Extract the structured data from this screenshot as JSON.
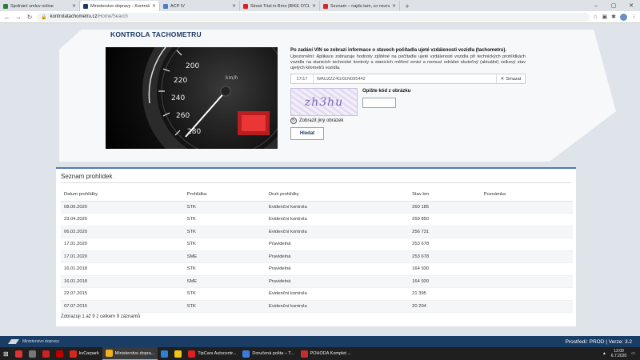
{
  "browser": {
    "tabs": [
      {
        "title": "Sjednání smluv online",
        "color": "#2a7d3f",
        "active": false
      },
      {
        "title": "Ministerstvo dopravy - Kontrola",
        "color": "#1d3b66",
        "active": true
      },
      {
        "title": "ACP IV",
        "color": "#4b7bc9",
        "active": false
      },
      {
        "title": "Street Trial in Brno |BIKE O'CLOCK",
        "color": "#e02020",
        "active": false
      },
      {
        "title": "Seznam – najdu tam, co neznám",
        "color": "#d6262b",
        "active": false
      }
    ],
    "new_tab": "+",
    "window_controls": [
      "–",
      "▢",
      "✕"
    ],
    "address_host": "kontrolatachometru.cz",
    "address_path": "/Home/Search"
  },
  "hero": {
    "title": "KONTROLA TACHOMETRU",
    "description_title": "Po zadání VIN se zobrazí informace o stavech počítadla ujeté vzdálenosti vozidla (tachometru).",
    "description": "Upozornění: Aplikace zobrazuje hodnoty zjištěné na počítadle ujeté vzdálenosti vozidla při technických prohlídkách vozidla na stanicích technické kontroly a stanicích měření emisí a nemusí odrážet skutečný (aktuální) celkový stav ujetých kilometrů vozidla.",
    "vin_counter": "17/17",
    "vin_value": "WAUZZZ4GXEN095442",
    "clear_label": "Smazat",
    "captcha_text": "zh3hu",
    "captcha_label": "Opište kód z obrázku",
    "reload_label": "Zobrazit jiný obrázek",
    "search_button": "Hledat",
    "speedo_labels": [
      "200",
      "220",
      "240",
      "260",
      "280",
      "km/h"
    ]
  },
  "inspections": {
    "title": "Seznam prohlídek",
    "columns": [
      "Datum prohlídky",
      "Prohlídka",
      "Druh prohlídky",
      "Stav km",
      "Poznámka"
    ],
    "rows": [
      [
        "08.06.2020",
        "STK",
        "Evidenční kontrola",
        "260 185",
        ""
      ],
      [
        "23.04.2020",
        "STK",
        "Evidenční kontrola",
        "259 850",
        ""
      ],
      [
        "06.02.2020",
        "STK",
        "Evidenční kontrola",
        "256 731",
        ""
      ],
      [
        "17.01.2020",
        "STK",
        "Pravidelná",
        "253 678",
        ""
      ],
      [
        "17.01.2020",
        "SME",
        "Pravidelná",
        "253 678",
        ""
      ],
      [
        "16.01.2018",
        "STK",
        "Pravidelná",
        "164 930",
        ""
      ],
      [
        "16.01.2018",
        "SME",
        "Pravidelná",
        "164 930",
        ""
      ],
      [
        "22.07.2015",
        "STK",
        "Evidenční kontrola",
        "21 395",
        ""
      ],
      [
        "07.07.2015",
        "STK",
        "Evidenční kontrola",
        "20 204",
        ""
      ]
    ],
    "footer": "Zobrazuji 1 až 9 z celkem 9 záznamů"
  },
  "status_bar": {
    "left": "Ministerstvo dopravy",
    "right": "Prostředí: PROD | Verze: 3.2"
  },
  "taskbar": {
    "items": [
      {
        "label": "",
        "color": "#d33",
        "active": false
      },
      {
        "label": "",
        "color": "#777",
        "active": false
      },
      {
        "label": "",
        "color": "#c22",
        "active": false
      },
      {
        "label": "",
        "color": "#b00",
        "active": false
      },
      {
        "label": "kvCarpark",
        "color": "#d9261c",
        "active": false
      },
      {
        "label": "Ministerstvo dopra...",
        "color": "#f2b01e",
        "active": true
      },
      {
        "label": "",
        "color": "#2f7fd6",
        "active": false
      },
      {
        "label": "",
        "color": "#f0c419",
        "active": false
      },
      {
        "label": "TipCars Autocentr...",
        "color": "#e02020",
        "active": false
      },
      {
        "label": "Doručená pošta – T...",
        "color": "#3b7ddd",
        "active": false
      },
      {
        "label": "POHODA Komplet ...",
        "color": "#c03030",
        "active": false
      }
    ],
    "time": "13:00",
    "date": "6.7.2020"
  }
}
